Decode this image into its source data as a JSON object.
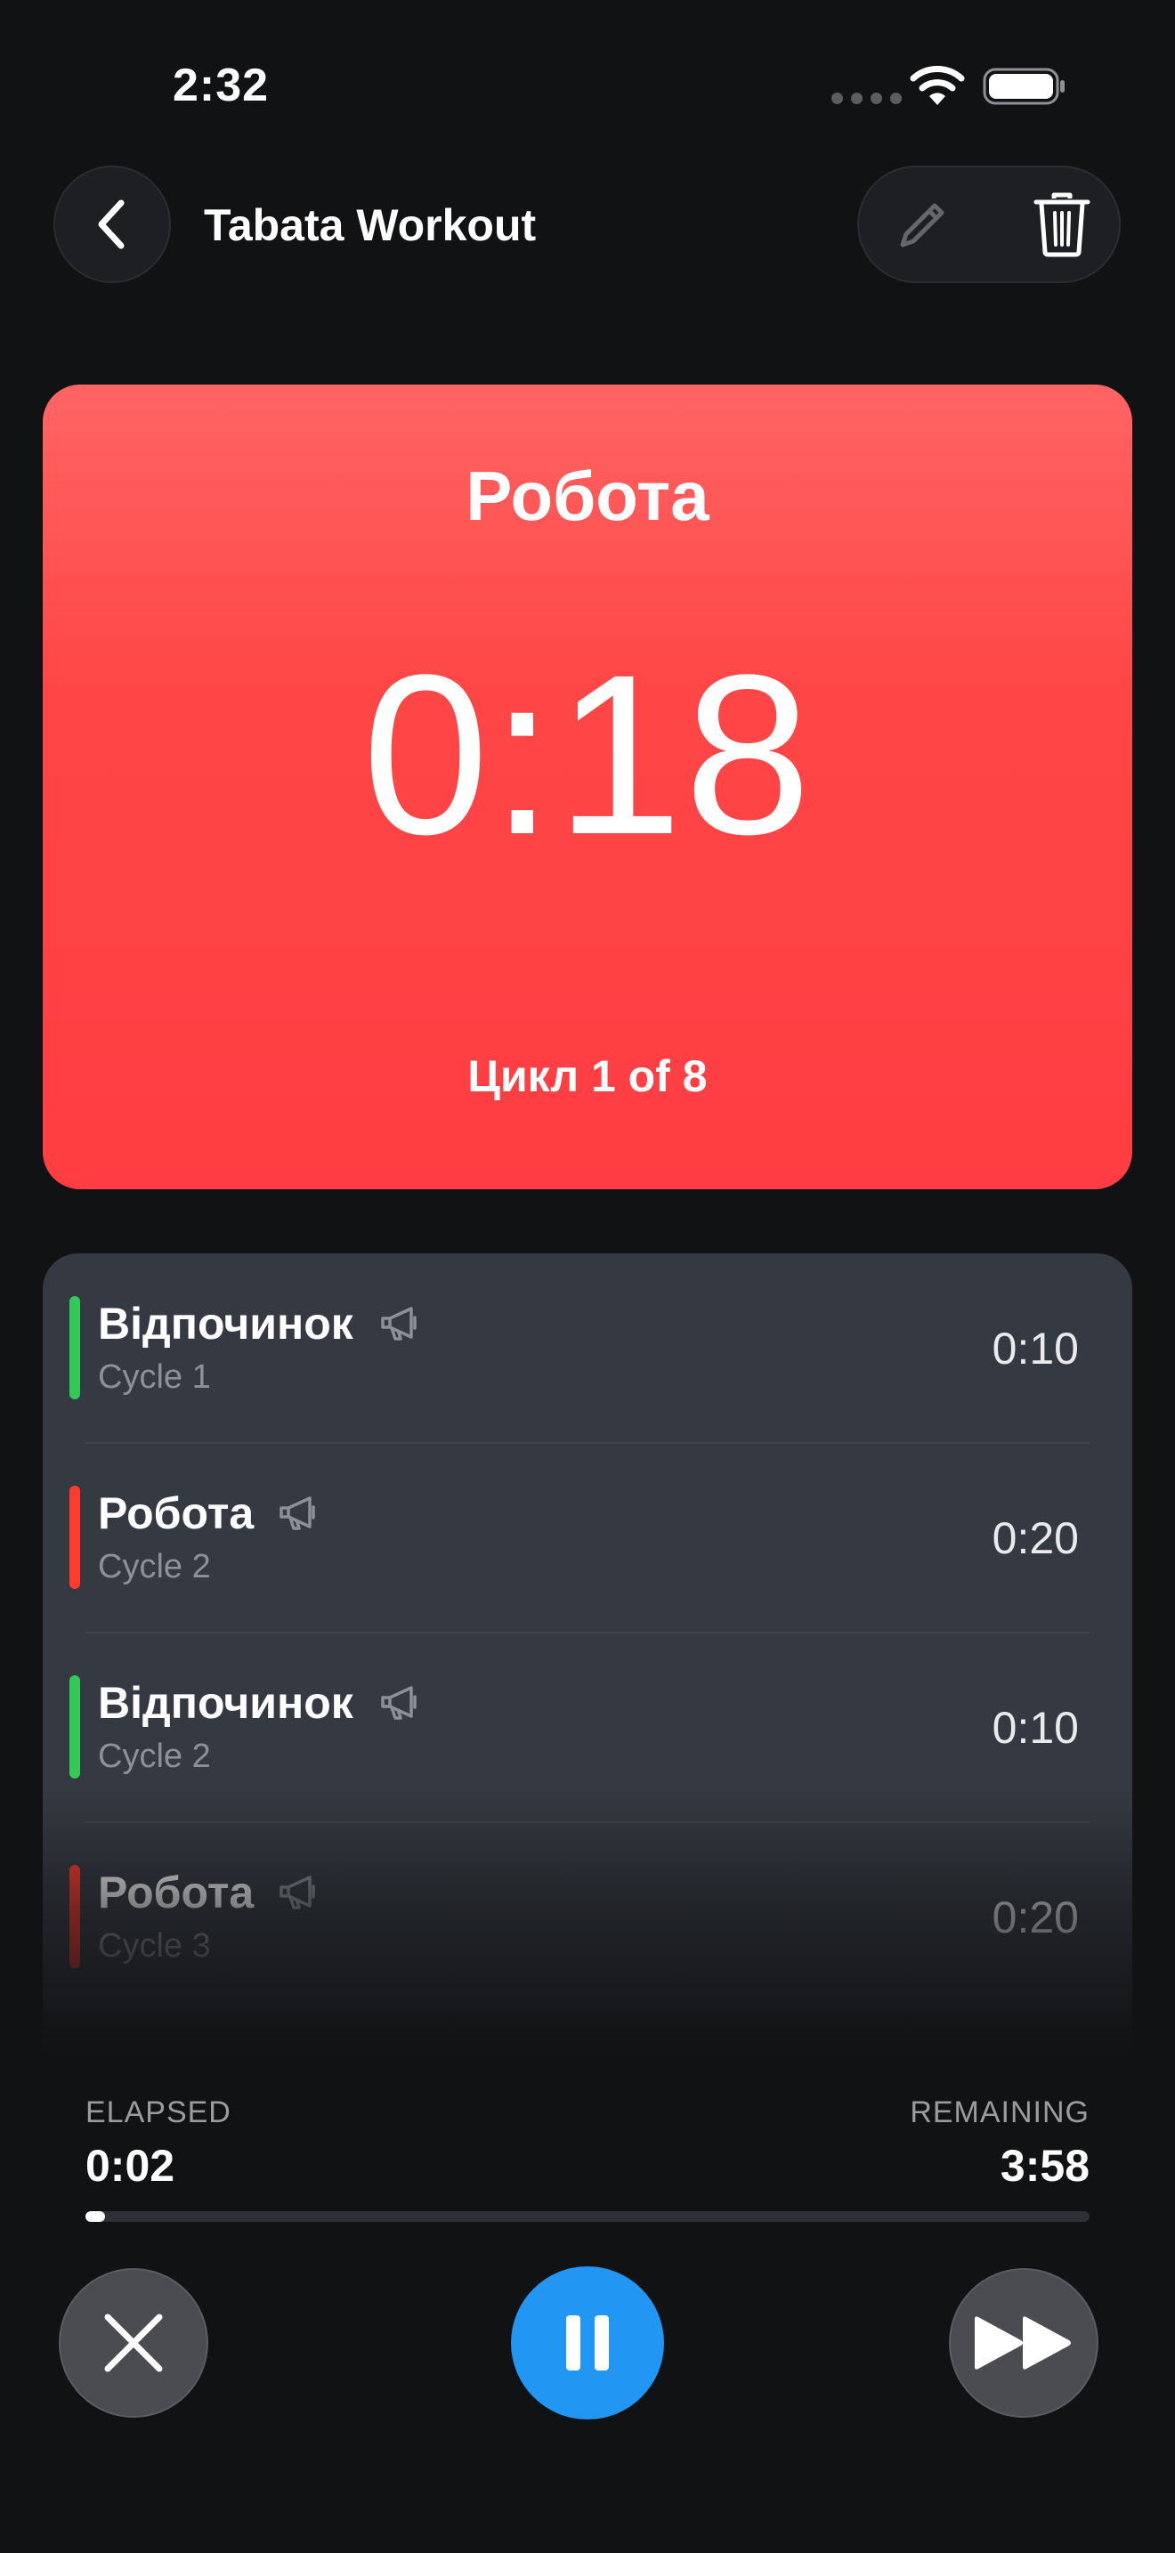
{
  "status_bar": {
    "time": "2:32"
  },
  "nav": {
    "title": "Tabata Workout"
  },
  "timer": {
    "phase": "Робота",
    "value": "0:18",
    "cycle": "Цикл 1 of 8",
    "color": "#ff4646"
  },
  "intervals": [
    {
      "name": "Відпочинок",
      "cycle": "Cycle 1",
      "duration": "0:10",
      "color": "#34c759",
      "icon": "megaphone-icon"
    },
    {
      "name": "Робота",
      "cycle": "Cycle 2",
      "duration": "0:20",
      "color": "#ff3b30",
      "icon": "megaphone-icon"
    },
    {
      "name": "Відпочинок",
      "cycle": "Cycle 2",
      "duration": "0:10",
      "color": "#34c759",
      "icon": "megaphone-icon"
    },
    {
      "name": "Робота",
      "cycle": "Cycle 3",
      "duration": "0:20",
      "color": "#ff3b30",
      "icon": "megaphone-icon"
    }
  ],
  "progress": {
    "elapsed_label": "ELAPSED",
    "elapsed": "0:02",
    "remaining_label": "REMAINING",
    "remaining": "3:58",
    "fraction": 0.008
  },
  "controls": {
    "stop_icon": "close-icon",
    "pause_icon": "pause-icon",
    "skip_icon": "fast-forward-icon",
    "accent": "#2196f3"
  }
}
